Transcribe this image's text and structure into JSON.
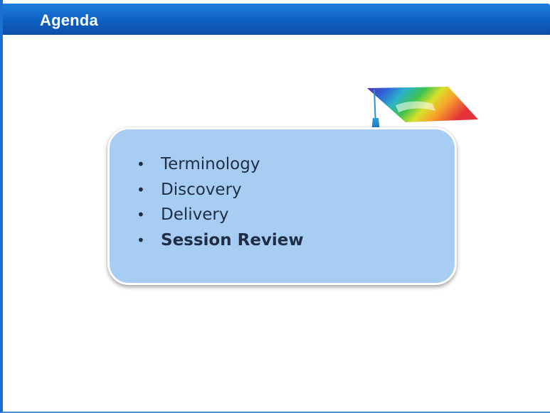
{
  "header": {
    "title": "Agenda"
  },
  "agenda": {
    "items": [
      {
        "label": "Terminology",
        "bold": false
      },
      {
        "label": "Discovery",
        "bold": false
      },
      {
        "label": "Delivery",
        "bold": false
      },
      {
        "label": "Session Review",
        "bold": true
      }
    ]
  },
  "icons": {
    "decoration": "graduation-cap-icon"
  },
  "colors": {
    "title_bar": "#1565c8",
    "title_text": "#ffffff",
    "card_fill": "#a8cdf3",
    "card_border": "#ffffff",
    "item_text": "#1f2e45"
  }
}
